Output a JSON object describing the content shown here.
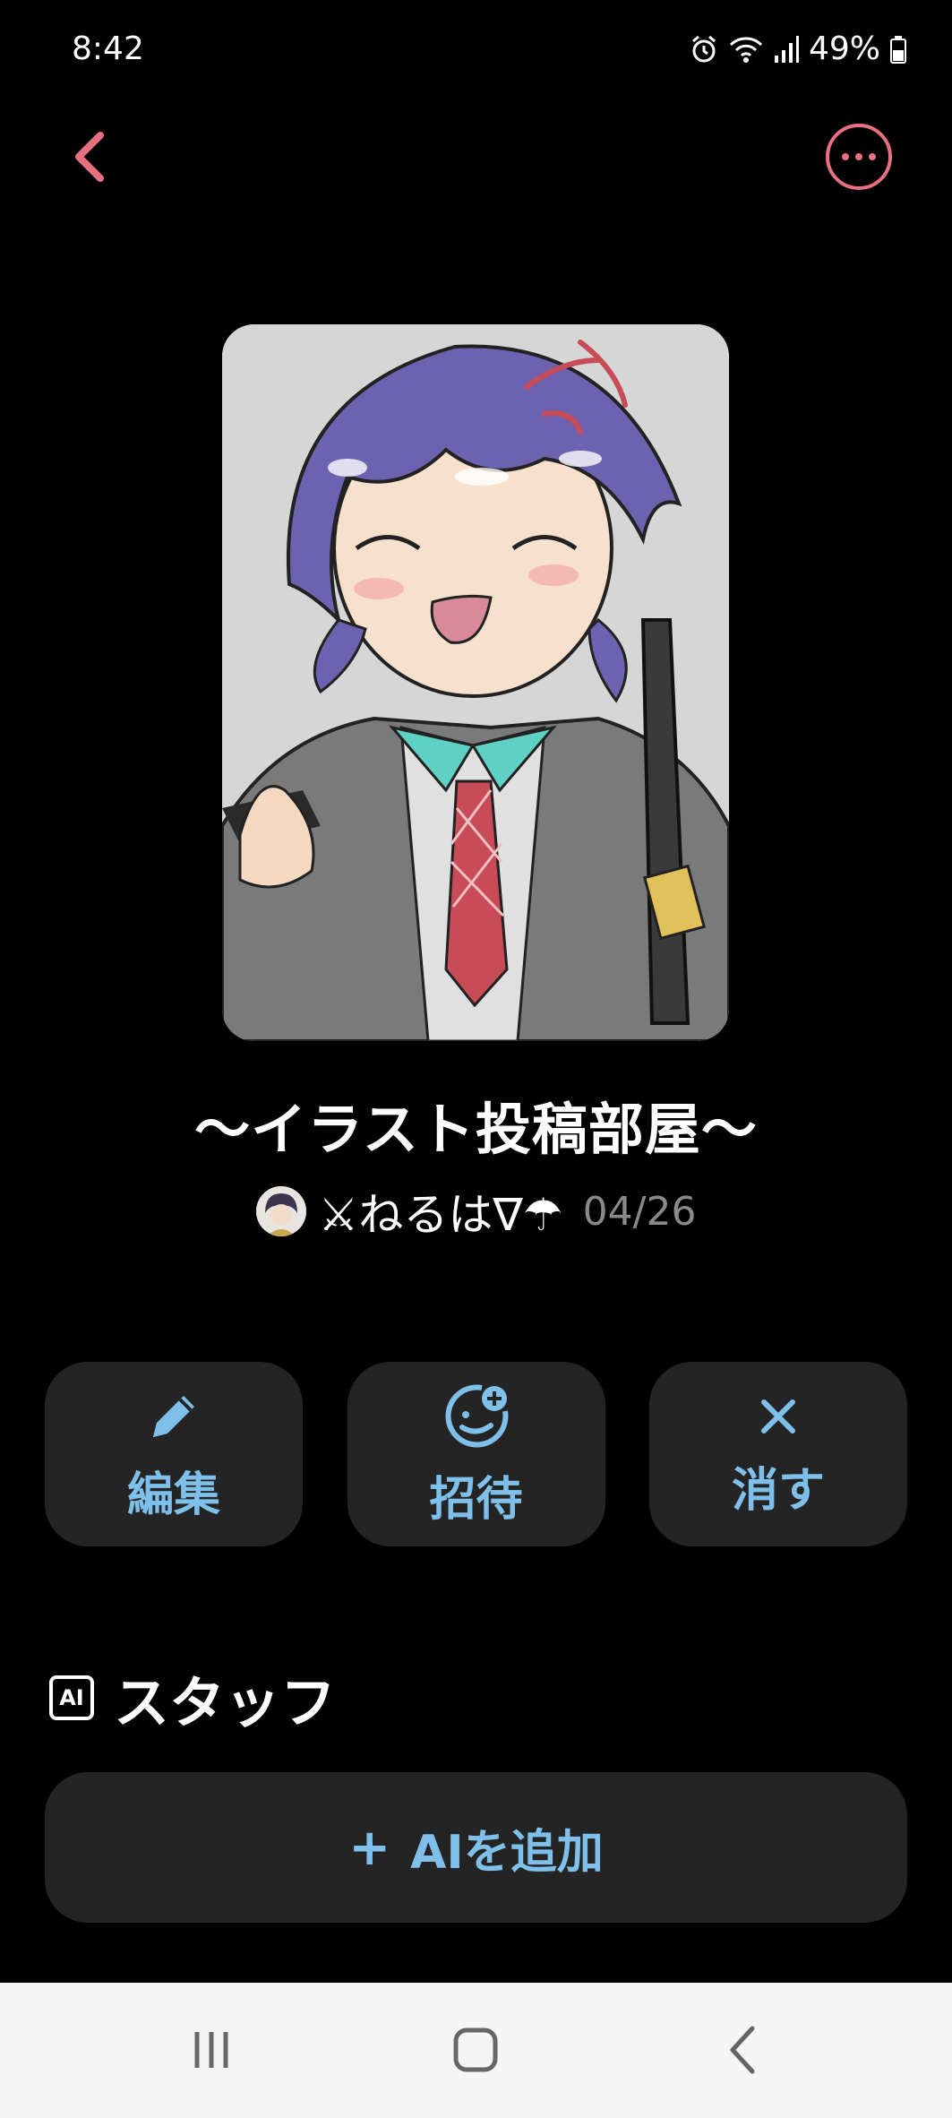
{
  "status_bar": {
    "time": "8:42",
    "battery": "49%"
  },
  "room": {
    "title": "〜イラスト投稿部屋〜",
    "owner": "⚔ねるは∇☂",
    "date": "04/26"
  },
  "actions": [
    {
      "label": "編集",
      "icon": "pencil-icon"
    },
    {
      "label": "招待",
      "icon": "invite-icon"
    },
    {
      "label": "消す",
      "icon": "close-icon"
    }
  ],
  "staff": {
    "ai_badge": "AI",
    "title": "スタッフ",
    "add_ai_label": "AIを追加",
    "add_ai_plus": "+"
  },
  "colors": {
    "accent_pink": "#e8707f",
    "accent_blue": "#7ec0ea",
    "button_bg": "#242424",
    "background": "#000000"
  }
}
